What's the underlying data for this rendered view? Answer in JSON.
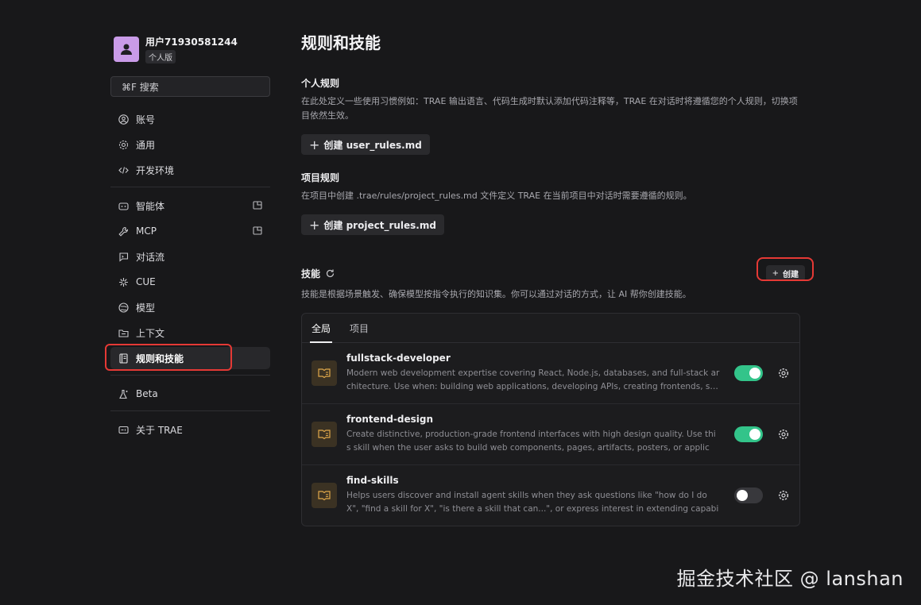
{
  "user": {
    "name": "用户71930581244",
    "plan": "个人版"
  },
  "search": {
    "label": "⌘F 搜索"
  },
  "sidebar": {
    "group1": [
      {
        "label": "账号",
        "icon": "user-circle-icon"
      },
      {
        "label": "通用",
        "icon": "gear-icon"
      },
      {
        "label": "开发环境",
        "icon": "code-icon"
      }
    ],
    "group2": [
      {
        "label": "智能体",
        "icon": "agent-icon",
        "external": true
      },
      {
        "label": "MCP",
        "icon": "wrench-icon",
        "external": true
      },
      {
        "label": "对话流",
        "icon": "chat-icon"
      },
      {
        "label": "CUE",
        "icon": "spark-icon"
      },
      {
        "label": "模型",
        "icon": "globe-icon"
      },
      {
        "label": "上下文",
        "icon": "folder-icon"
      },
      {
        "label": "规则和技能",
        "icon": "book-icon",
        "active": true
      }
    ],
    "group3": [
      {
        "label": "Beta",
        "icon": "flask-icon"
      }
    ],
    "group4": [
      {
        "label": "关于 TRAE",
        "icon": "info-box-icon"
      }
    ]
  },
  "main": {
    "title": "规则和技能",
    "personal": {
      "title": "个人规则",
      "desc": "在此处定义一些使用习惯例如：TRAE 输出语言、代码生成时默认添加代码注释等，TRAE 在对话时将遵循您的个人规则，切换项目依然生效。",
      "button": "创建 user_rules.md"
    },
    "project": {
      "title": "项目规则",
      "desc": "在项目中创建 .trae/rules/project_rules.md 文件定义 TRAE 在当前项目中对话时需要遵循的规则。",
      "button": "创建 project_rules.md"
    },
    "skills": {
      "title": "技能",
      "create": "创建",
      "desc": "技能是根据场景触发、确保模型按指令执行的知识集。你可以通过对话的方式，让 AI 帮你创建技能。",
      "tabs": [
        "全局",
        "项目"
      ],
      "items": [
        {
          "name": "fullstack-developer",
          "desc": "Modern web development expertise covering React, Node.js, databases, and full-stack architecture. Use when: building web applications, developing APIs, creating frontends, s…",
          "enabled": true
        },
        {
          "name": "frontend-design",
          "desc": "Create distinctive, production-grade frontend interfaces with high design quality. Use this skill when the user asks to build web components, pages, artifacts, posters, or applica…",
          "enabled": true
        },
        {
          "name": "find-skills",
          "desc": "Helps users discover and install agent skills when they ask questions like \"how do I do X\", \"find a skill for X\", \"is there a skill that can...\", or express interest in extending capabiliti…",
          "enabled": false
        }
      ]
    }
  },
  "watermark": "掘金技术社区 @ lanshan",
  "colors": {
    "accent": "#33c48a",
    "highlight": "#e53935",
    "avatar": "#c99be8"
  }
}
